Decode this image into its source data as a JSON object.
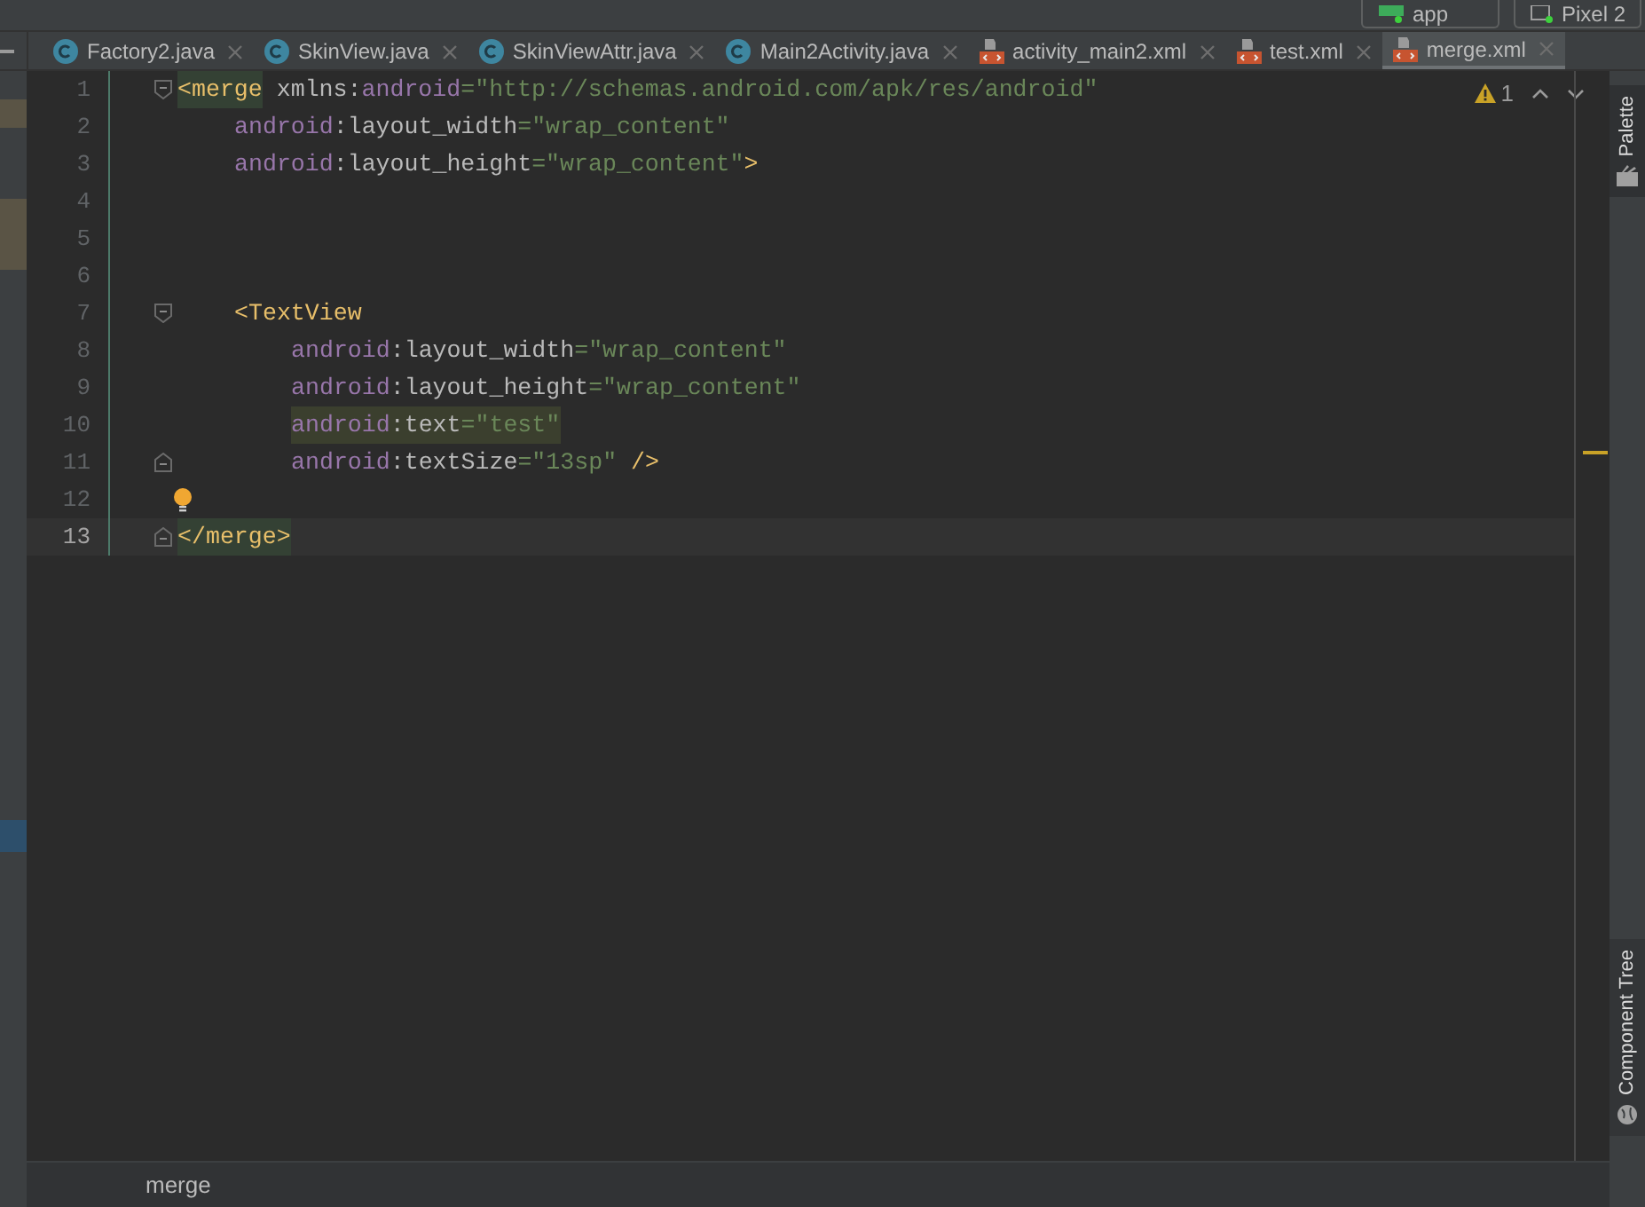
{
  "toolbar": {
    "run_config": "app",
    "device": "Pixel 2"
  },
  "tabs": [
    {
      "label": "Factory2.java",
      "kind": "class",
      "selected": false
    },
    {
      "label": "SkinView.java",
      "kind": "class",
      "selected": false
    },
    {
      "label": "SkinViewAttr.java",
      "kind": "class",
      "selected": false
    },
    {
      "label": "Main2Activity.java",
      "kind": "class",
      "selected": false
    },
    {
      "label": "activity_main2.xml",
      "kind": "xml",
      "selected": false
    },
    {
      "label": "test.xml",
      "kind": "xml",
      "selected": false
    },
    {
      "label": "merge.xml",
      "kind": "xml",
      "selected": true
    }
  ],
  "inspections": {
    "warnings": "1"
  },
  "lines": [
    {
      "number": "1",
      "kind": "fold-start",
      "current": false,
      "tokens": [
        {
          "kind": "tag",
          "text": "<merge",
          "matched": true
        },
        {
          "kind": "attr",
          "text": " xmlns:"
        },
        {
          "kind": "ns",
          "text": "android"
        },
        {
          "kind": "str",
          "text": "=\"http://schemas.android.com/apk/res/android\""
        }
      ],
      "children": [
        {
          "number": "2",
          "kind": "line",
          "current": false,
          "tokens": [
            {
              "kind": "ns",
              "text": "android"
            },
            {
              "kind": "attr",
              "text": ":layout_width"
            },
            {
              "kind": "str",
              "text": "=\"wrap_content\""
            }
          ]
        },
        {
          "number": "3",
          "kind": "line",
          "current": false,
          "tokens": [
            {
              "kind": "ns",
              "text": "android"
            },
            {
              "kind": "attr",
              "text": ":layout_height"
            },
            {
              "kind": "str",
              "text": "=\"wrap_content\""
            },
            {
              "kind": "tag",
              "text": ">"
            }
          ]
        },
        {
          "number": "4",
          "kind": "line",
          "current": false
        },
        {
          "number": "5",
          "kind": "line",
          "current": false
        },
        {
          "number": "6",
          "kind": "line",
          "current": false
        },
        {
          "number": "7",
          "kind": "fold-start",
          "current": false,
          "tokens": [
            {
              "kind": "tag",
              "text": "<TextView"
            }
          ],
          "children": [
            {
              "number": "8",
              "kind": "line",
              "current": false,
              "tokens": [
                {
                  "kind": "ns",
                  "text": "android"
                },
                {
                  "kind": "attr",
                  "text": ":layout_width"
                },
                {
                  "kind": "str",
                  "text": "=\"wrap_content\""
                }
              ]
            },
            {
              "number": "9",
              "kind": "line",
              "current": false,
              "tokens": [
                {
                  "kind": "ns",
                  "text": "android"
                },
                {
                  "kind": "attr",
                  "text": ":layout_height"
                },
                {
                  "kind": "str",
                  "text": "=\"wrap_content\""
                }
              ]
            },
            {
              "number": "10",
              "kind": "line",
              "current": false,
              "highlighted": true,
              "tokens": [
                {
                  "kind": "ns",
                  "text": "android"
                },
                {
                  "kind": "attr",
                  "text": ":text"
                },
                {
                  "kind": "str",
                  "text": "=\"test\""
                }
              ]
            },
            {
              "number": "11",
              "kind": "fold-end",
              "current": false,
              "tokens": [
                {
                  "kind": "ns",
                  "text": "android"
                },
                {
                  "kind": "attr",
                  "text": ":textSize"
                },
                {
                  "kind": "str",
                  "text": "=\"13sp\""
                },
                {
                  "kind": "tag",
                  "text": " />"
                }
              ]
            }
          ]
        }
      ]
    },
    {
      "number": "12",
      "kind": "line",
      "current": false,
      "intention": true
    },
    {
      "number": "13",
      "kind": "fold-end",
      "current": true,
      "tokens": [
        {
          "kind": "tag",
          "text": "</merge>",
          "matched": true
        }
      ]
    }
  ],
  "side_panels": [
    {
      "label": "Palette",
      "kind": "palette"
    },
    {
      "label": "Component Tree",
      "kind": "tree"
    }
  ],
  "breadcrumb": "merge"
}
